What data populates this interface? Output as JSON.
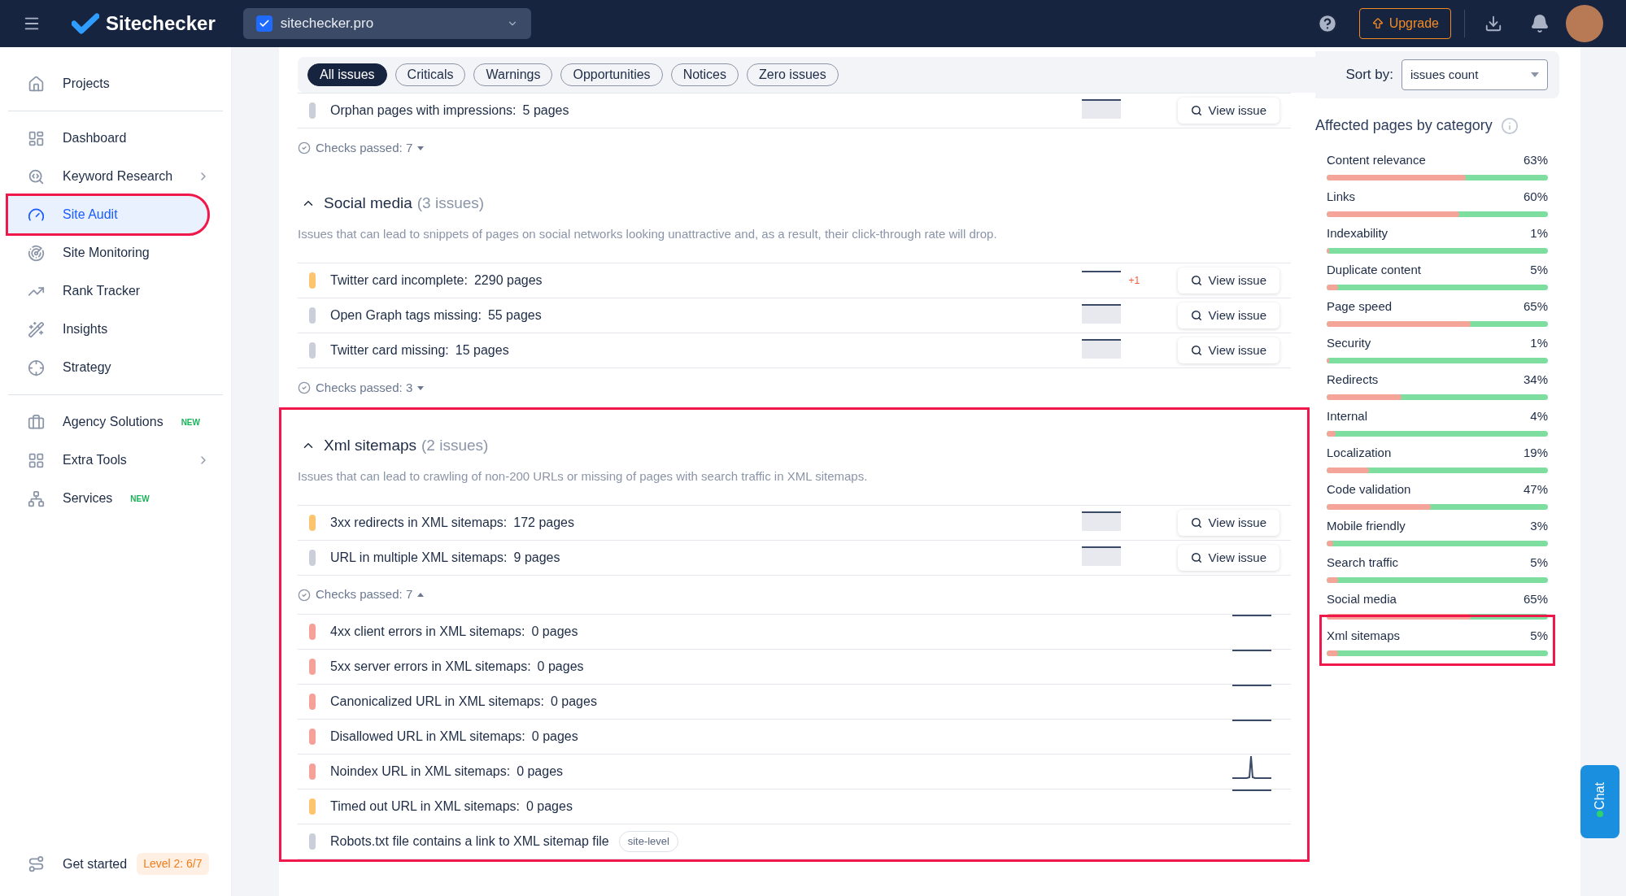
{
  "topbar": {
    "logo": "Sitechecker",
    "project": "sitechecker.pro",
    "upgrade": "Upgrade"
  },
  "sidebar": {
    "groups": [
      [
        {
          "label": "Projects",
          "selected": false,
          "highlighted": false
        }
      ],
      [
        {
          "label": "Dashboard",
          "selected": false,
          "highlighted": false
        },
        {
          "label": "Keyword Research",
          "selected": false,
          "highlighted": false,
          "chevron": true
        },
        {
          "label": "Site Audit",
          "selected": true,
          "highlighted": true
        },
        {
          "label": "Site Monitoring",
          "selected": false,
          "highlighted": false
        },
        {
          "label": "Rank Tracker",
          "selected": false,
          "highlighted": false
        },
        {
          "label": "Insights",
          "selected": false,
          "highlighted": false
        },
        {
          "label": "Strategy",
          "selected": false,
          "highlighted": false
        }
      ],
      [
        {
          "label": "Agency Solutions",
          "selected": false,
          "highlighted": false,
          "badge": "NEW"
        },
        {
          "label": "Extra Tools",
          "selected": false,
          "highlighted": false,
          "chevron": true
        },
        {
          "label": "Services",
          "selected": false,
          "highlighted": false,
          "badge": "NEW"
        }
      ]
    ],
    "footer": {
      "label": "Get started",
      "level": "Level 2: 6/7"
    }
  },
  "filters": [
    {
      "label": "All issues",
      "selected": true
    },
    {
      "label": "Criticals",
      "selected": false
    },
    {
      "label": "Warnings",
      "selected": false
    },
    {
      "label": "Opportunities",
      "selected": false
    },
    {
      "label": "Notices",
      "selected": false
    },
    {
      "label": "Zero issues",
      "selected": false
    }
  ],
  "sort": {
    "label": "Sort by:",
    "value": "issues count"
  },
  "sections": [
    {
      "highlighted": false,
      "issues": [
        {
          "name": "Orphan pages with impressions:",
          "pages": "5 pages",
          "color": "#c9ced8",
          "kind": "area",
          "action": "View issue"
        }
      ],
      "checks_passed": "Checks passed: 7",
      "checks_expanded": false
    },
    {
      "title": "Social media",
      "count": "(3 issues)",
      "description": "Issues that can lead to snippets of pages on social networks looking unattractive and, as a result, their click-through rate will drop.",
      "highlighted": false,
      "expanded": true,
      "issues": [
        {
          "name": "Twitter card incomplete:",
          "pages": "2290 pages",
          "color": "#fcc46f",
          "kind": "line",
          "delta": "+1",
          "action": "View issue"
        },
        {
          "name": "Open Graph tags missing:",
          "pages": "55 pages",
          "color": "#c9ced8",
          "kind": "area",
          "action": "View issue"
        },
        {
          "name": "Twitter card missing:",
          "pages": "15 pages",
          "color": "#c9ced8",
          "kind": "area",
          "action": "View issue"
        }
      ],
      "checks_passed": "Checks passed: 3",
      "checks_expanded": false
    },
    {
      "title": "Xml sitemaps",
      "count": "(2 issues)",
      "description": "Issues that can lead to crawling of non-200 URLs or missing of pages with search traffic in XML sitemaps.",
      "highlighted": true,
      "expanded": true,
      "issues": [
        {
          "name": "3xx redirects in XML sitemaps:",
          "pages": "172 pages",
          "color": "#fcc46f",
          "kind": "area",
          "action": "View issue"
        },
        {
          "name": "URL in multiple XML sitemaps:",
          "pages": "9 pages",
          "color": "#c9ced8",
          "kind": "area",
          "action": "View issue"
        }
      ],
      "checks_passed": "Checks passed: 7",
      "checks_expanded": true,
      "passed": [
        {
          "name": "4xx client errors in XML sitemaps:",
          "pages": "0 pages",
          "color": "#f5a19a",
          "kind": "flat"
        },
        {
          "name": "5xx server errors in XML sitemaps:",
          "pages": "0 pages",
          "color": "#f5a19a",
          "kind": "flat"
        },
        {
          "name": "Canonicalized URL in XML sitemaps:",
          "pages": "0 pages",
          "color": "#f5a19a",
          "kind": "flat"
        },
        {
          "name": "Disallowed URL in XML sitemaps:",
          "pages": "0 pages",
          "color": "#f5a19a",
          "kind": "flat"
        },
        {
          "name": "Noindex URL in XML sitemaps:",
          "pages": "0 pages",
          "color": "#f5a19a",
          "kind": "spike"
        },
        {
          "name": "Timed out URL in XML sitemaps:",
          "pages": "0 pages",
          "color": "#fcc46f",
          "kind": "flat"
        },
        {
          "name": "Robots.txt file contains a link to XML sitemap file",
          "tag": "site-level",
          "color": "#c9ced8",
          "kind": "none"
        }
      ]
    }
  ],
  "categories": {
    "title": "Affected pages by category",
    "items": [
      {
        "name": "Content relevance",
        "percent": "63%",
        "level": 0.63,
        "highlighted": false
      },
      {
        "name": "Links",
        "percent": "60%",
        "level": 0.6,
        "highlighted": false
      },
      {
        "name": "Indexability",
        "percent": "1%",
        "level": 0.01,
        "highlighted": false
      },
      {
        "name": "Duplicate content",
        "percent": "5%",
        "level": 0.05,
        "highlighted": false
      },
      {
        "name": "Page speed",
        "percent": "65%",
        "level": 0.65,
        "highlighted": false
      },
      {
        "name": "Security",
        "percent": "1%",
        "level": 0.01,
        "highlighted": false
      },
      {
        "name": "Redirects",
        "percent": "34%",
        "level": 0.34,
        "highlighted": false
      },
      {
        "name": "Internal",
        "percent": "4%",
        "level": 0.04,
        "highlighted": false
      },
      {
        "name": "Localization",
        "percent": "19%",
        "level": 0.19,
        "highlighted": false
      },
      {
        "name": "Code validation",
        "percent": "47%",
        "level": 0.47,
        "highlighted": false
      },
      {
        "name": "Mobile friendly",
        "percent": "3%",
        "level": 0.03,
        "highlighted": false
      },
      {
        "name": "Search traffic",
        "percent": "5%",
        "level": 0.05,
        "highlighted": false
      },
      {
        "name": "Social media",
        "percent": "65%",
        "level": 0.65,
        "highlighted": false
      },
      {
        "name": "Xml sitemaps",
        "percent": "5%",
        "level": 0.05,
        "highlighted": true
      }
    ]
  },
  "chat": "Chat"
}
